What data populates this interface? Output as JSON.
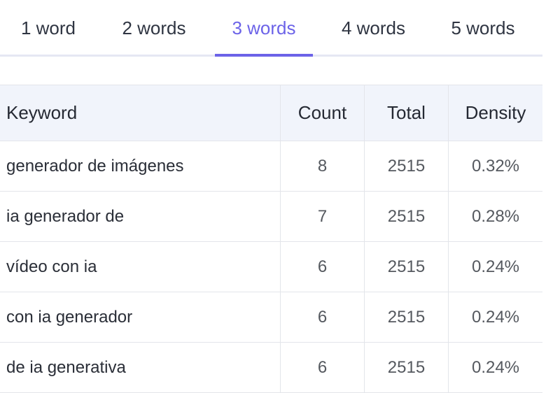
{
  "tabs": [
    {
      "label": "1 word",
      "active": false
    },
    {
      "label": "2 words",
      "active": false
    },
    {
      "label": "3 words",
      "active": true
    },
    {
      "label": "4 words",
      "active": false
    },
    {
      "label": "5 words",
      "active": false
    }
  ],
  "colors": {
    "accent": "#6c63e8",
    "header_bg": "#f1f4fb",
    "border": "#e3e5ea"
  },
  "table": {
    "headers": {
      "keyword": "Keyword",
      "count": "Count",
      "total": "Total",
      "density": "Density"
    },
    "rows": [
      {
        "keyword": "generador de imágenes",
        "count": "8",
        "total": "2515",
        "density": "0.32%"
      },
      {
        "keyword": "ia generador de",
        "count": "7",
        "total": "2515",
        "density": "0.28%"
      },
      {
        "keyword": "vídeo con ia",
        "count": "6",
        "total": "2515",
        "density": "0.24%"
      },
      {
        "keyword": "con ia generador",
        "count": "6",
        "total": "2515",
        "density": "0.24%"
      },
      {
        "keyword": "de ia generativa",
        "count": "6",
        "total": "2515",
        "density": "0.24%"
      }
    ]
  }
}
